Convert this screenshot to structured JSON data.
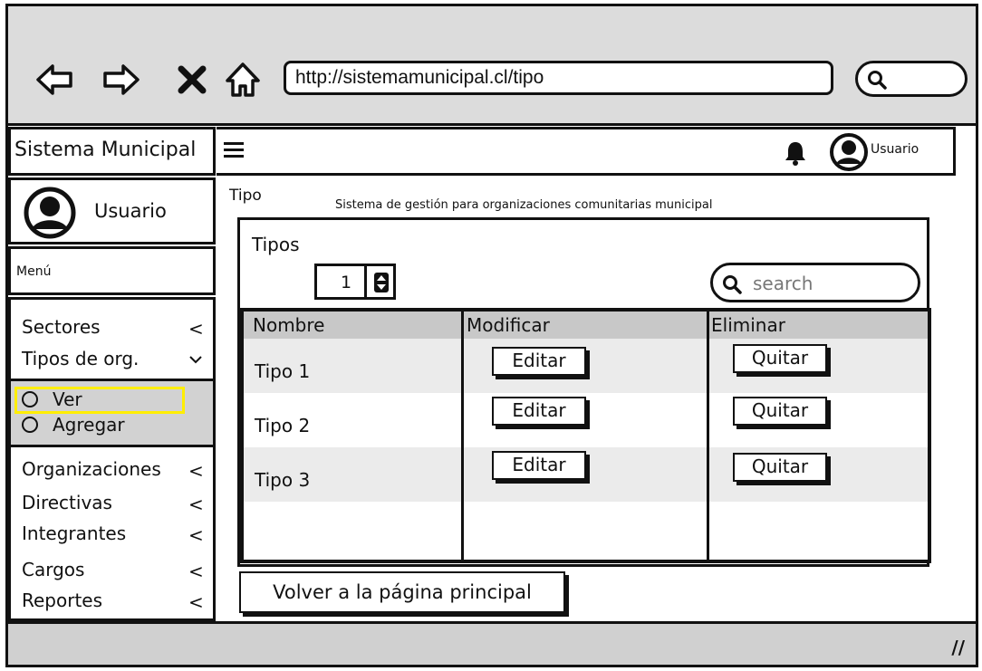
{
  "browser": {
    "url": "http://sistemamunicipal.cl/tipo"
  },
  "header": {
    "brand": "Sistema Municipal",
    "user_label": "Usuario"
  },
  "sidebar": {
    "user_name": "Usuario",
    "menu_label": "Menú",
    "items": [
      {
        "label": "Sectores",
        "chevron": "<"
      },
      {
        "label": "Tipos de org.",
        "chevron": "v"
      },
      {
        "label": "Organizaciones",
        "chevron": "<"
      },
      {
        "label": "Directivas",
        "chevron": "<"
      },
      {
        "label": "Integrantes",
        "chevron": "<"
      },
      {
        "label": "Cargos",
        "chevron": "<"
      },
      {
        "label": "Reportes",
        "chevron": "<"
      }
    ],
    "subitems": [
      {
        "label": "Ver",
        "selected": true
      },
      {
        "label": "Agregar",
        "selected": false
      }
    ]
  },
  "main": {
    "title": "Tipo",
    "subtitle": "Sistema de gestión para organizaciones comunitarias municipal",
    "panel_title": "Tipos",
    "stepper_value": "1",
    "search_placeholder": "search",
    "table": {
      "columns": [
        "Nombre",
        "Modificar",
        "Eliminar"
      ],
      "rows": [
        {
          "name": "Tipo 1",
          "edit": "Editar",
          "remove": "Quitar"
        },
        {
          "name": "Tipo 2",
          "edit": "Editar",
          "remove": "Quitar"
        },
        {
          "name": "Tipo 3",
          "edit": "Editar",
          "remove": "Quitar"
        }
      ]
    },
    "back_button": "Volver a la página principal"
  },
  "colors": {
    "topbar": "#dcdcdc",
    "highlight": "#ffee00",
    "row_alt": "#ebebeb"
  }
}
